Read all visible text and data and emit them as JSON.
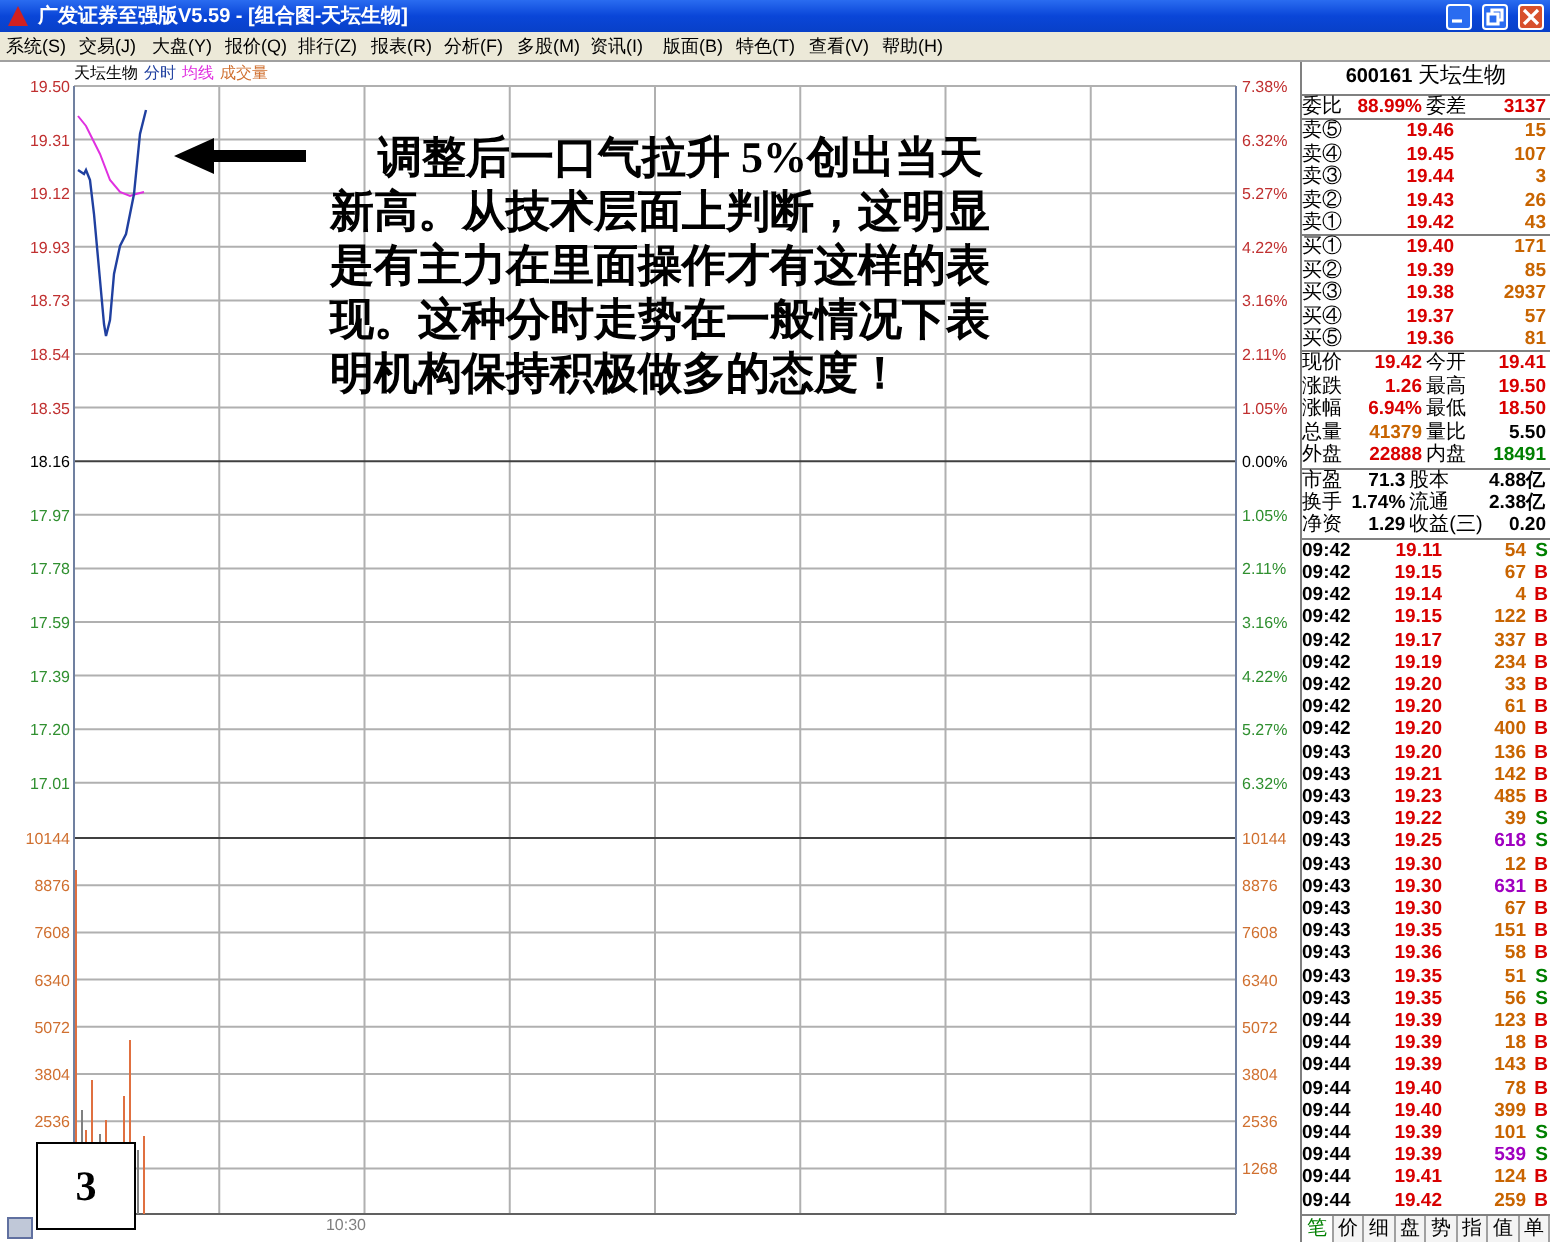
{
  "window": {
    "title": "广发证券至强版V5.59 - [组合图-天坛生物]"
  },
  "menu": [
    "系统(S)",
    "交易(J)",
    "大盘(Y)",
    "报价(Q)",
    "排行(Z)",
    "报表(R)",
    "分析(F)",
    "多股(M)",
    "资讯(I)",
    "版面(B)",
    "特色(T)",
    "查看(V)",
    "帮助(H)"
  ],
  "chart": {
    "legend": [
      {
        "label": "天坛生物",
        "color": "#000000"
      },
      {
        "label": "分时",
        "color": "#2040a0"
      },
      {
        "label": "均线",
        "color": "#e030e0"
      },
      {
        "label": "成交量",
        "color": "#d07030"
      }
    ],
    "left_price_axis": [
      {
        "label": "19.50",
        "color": "#c03030"
      },
      {
        "label": "19.31",
        "color": "#c03030"
      },
      {
        "label": "19.12",
        "color": "#c03030"
      },
      {
        "label": "19.93",
        "color": "#c03030"
      },
      {
        "label": "18.73",
        "color": "#c03030"
      },
      {
        "label": "18.54",
        "color": "#c03030"
      },
      {
        "label": "18.35",
        "color": "#c03030"
      },
      {
        "label": "18.16",
        "color": "#000000"
      },
      {
        "label": "17.97",
        "color": "#309030"
      },
      {
        "label": "17.78",
        "color": "#309030"
      },
      {
        "label": "17.59",
        "color": "#309030"
      },
      {
        "label": "17.39",
        "color": "#309030"
      },
      {
        "label": "17.20",
        "color": "#309030"
      },
      {
        "label": "17.01",
        "color": "#309030"
      }
    ],
    "right_percent_axis": [
      {
        "label": "7.38%",
        "color": "#c03030"
      },
      {
        "label": "6.32%",
        "color": "#c03030"
      },
      {
        "label": "5.27%",
        "color": "#c03030"
      },
      {
        "label": "4.22%",
        "color": "#c03030"
      },
      {
        "label": "3.16%",
        "color": "#c03030"
      },
      {
        "label": "2.11%",
        "color": "#c03030"
      },
      {
        "label": "1.05%",
        "color": "#c03030"
      },
      {
        "label": "0.00%",
        "color": "#000000"
      },
      {
        "label": "1.05%",
        "color": "#309030"
      },
      {
        "label": "2.11%",
        "color": "#309030"
      },
      {
        "label": "3.16%",
        "color": "#309030"
      },
      {
        "label": "4.22%",
        "color": "#309030"
      },
      {
        "label": "5.27%",
        "color": "#309030"
      },
      {
        "label": "6.32%",
        "color": "#309030"
      }
    ],
    "left_volume_axis": [
      "10144",
      "8876",
      "7608",
      "6340",
      "5072",
      "3804",
      "2536"
    ],
    "right_volume_axis": [
      "10144",
      "8876",
      "7608",
      "6340",
      "5072",
      "3804",
      "2536",
      "1268"
    ],
    "time_label": "10:30"
  },
  "annotation": {
    "text": "调整后一口气拉升 5%创出当天新高。从技术层面上判断，这明显是有主力在里面操作才有这样的表现。这种分时走势在一般情况下表明机构保持积极做多的态度！",
    "slide_number": "3"
  },
  "quote": {
    "code": "600161",
    "name": "天坛生物",
    "summary": [
      {
        "cells": [
          {
            "label": "委比",
            "value": "88.99%",
            "color": "#d80000"
          },
          {
            "label": "委差",
            "value": "3137",
            "color": "#d80000"
          }
        ]
      }
    ],
    "asks": [
      {
        "label": "卖⑤",
        "price": "19.46",
        "volume": "15"
      },
      {
        "label": "卖④",
        "price": "19.45",
        "volume": "107"
      },
      {
        "label": "卖③",
        "price": "19.44",
        "volume": "3"
      },
      {
        "label": "卖②",
        "price": "19.43",
        "volume": "26"
      },
      {
        "label": "卖①",
        "price": "19.42",
        "volume": "43"
      }
    ],
    "bids": [
      {
        "label": "买①",
        "price": "19.40",
        "volume": "171"
      },
      {
        "label": "买②",
        "price": "19.39",
        "volume": "85"
      },
      {
        "label": "买③",
        "price": "19.38",
        "volume": "2937"
      },
      {
        "label": "买④",
        "price": "19.37",
        "volume": "57"
      },
      {
        "label": "买⑤",
        "price": "19.36",
        "volume": "81"
      }
    ],
    "stats": [
      {
        "cells": [
          {
            "label": "现价",
            "value": "19.42",
            "color": "#d80000"
          },
          {
            "label": "今开",
            "value": "19.41",
            "color": "#d80000"
          }
        ]
      },
      {
        "cells": [
          {
            "label": "涨跌",
            "value": "1.26",
            "color": "#d80000"
          },
          {
            "label": "最高",
            "value": "19.50",
            "color": "#d80000"
          }
        ]
      },
      {
        "cells": [
          {
            "label": "涨幅",
            "value": "6.94%",
            "color": "#d80000"
          },
          {
            "label": "最低",
            "value": "18.50",
            "color": "#d80000"
          }
        ]
      },
      {
        "cells": [
          {
            "label": "总量",
            "value": "41379",
            "color": "#c86400"
          },
          {
            "label": "量比",
            "value": "5.50",
            "color": "#000000"
          }
        ]
      },
      {
        "cells": [
          {
            "label": "外盘",
            "value": "22888",
            "color": "#d80000"
          },
          {
            "label": "内盘",
            "value": "18491",
            "color": "#008000"
          }
        ]
      }
    ],
    "fundamentals": [
      {
        "cells": [
          {
            "label": "市盈",
            "value": "71.3",
            "color": "#000000"
          },
          {
            "label": "股本",
            "value": "4.88亿",
            "color": "#000000"
          }
        ]
      },
      {
        "cells": [
          {
            "label": "换手",
            "value": "1.74%",
            "color": "#000000"
          },
          {
            "label": "流通",
            "value": "2.38亿",
            "color": "#000000"
          }
        ]
      },
      {
        "cells": [
          {
            "label": "净资",
            "value": "1.29",
            "color": "#000000"
          },
          {
            "label": "收益(三)",
            "value": "0.20",
            "color": "#000000"
          }
        ]
      }
    ]
  },
  "trades": [
    {
      "time": "09:42",
      "price": "19.11",
      "volume": "54",
      "big": false,
      "side": "S",
      "kind": "sell"
    },
    {
      "time": "09:42",
      "price": "19.15",
      "volume": "67",
      "big": false,
      "side": "B",
      "kind": "buy"
    },
    {
      "time": "09:42",
      "price": "19.14",
      "volume": "4",
      "big": false,
      "side": "B",
      "kind": "buy"
    },
    {
      "time": "09:42",
      "price": "19.15",
      "volume": "122",
      "big": false,
      "side": "B",
      "kind": "buy"
    },
    {
      "time": "09:42",
      "price": "19.17",
      "volume": "337",
      "big": false,
      "side": "B",
      "kind": "buy"
    },
    {
      "time": "09:42",
      "price": "19.19",
      "volume": "234",
      "big": false,
      "side": "B",
      "kind": "buy"
    },
    {
      "time": "09:42",
      "price": "19.20",
      "volume": "33",
      "big": false,
      "side": "B",
      "kind": "buy"
    },
    {
      "time": "09:42",
      "price": "19.20",
      "volume": "61",
      "big": false,
      "side": "B",
      "kind": "buy"
    },
    {
      "time": "09:42",
      "price": "19.20",
      "volume": "400",
      "big": false,
      "side": "B",
      "kind": "buy"
    },
    {
      "time": "09:43",
      "price": "19.20",
      "volume": "136",
      "big": false,
      "side": "B",
      "kind": "buy"
    },
    {
      "time": "09:43",
      "price": "19.21",
      "volume": "142",
      "big": false,
      "side": "B",
      "kind": "buy"
    },
    {
      "time": "09:43",
      "price": "19.23",
      "volume": "485",
      "big": false,
      "side": "B",
      "kind": "buy"
    },
    {
      "time": "09:43",
      "price": "19.22",
      "volume": "39",
      "big": false,
      "side": "S",
      "kind": "sell"
    },
    {
      "time": "09:43",
      "price": "19.25",
      "volume": "618",
      "big": true,
      "side": "S",
      "kind": "sell"
    },
    {
      "time": "09:43",
      "price": "19.30",
      "volume": "12",
      "big": false,
      "side": "B",
      "kind": "buy"
    },
    {
      "time": "09:43",
      "price": "19.30",
      "volume": "631",
      "big": true,
      "side": "B",
      "kind": "buy"
    },
    {
      "time": "09:43",
      "price": "19.30",
      "volume": "67",
      "big": false,
      "side": "B",
      "kind": "buy"
    },
    {
      "time": "09:43",
      "price": "19.35",
      "volume": "151",
      "big": false,
      "side": "B",
      "kind": "buy"
    },
    {
      "time": "09:43",
      "price": "19.36",
      "volume": "58",
      "big": false,
      "side": "B",
      "kind": "buy"
    },
    {
      "time": "09:43",
      "price": "19.35",
      "volume": "51",
      "big": false,
      "side": "S",
      "kind": "sell"
    },
    {
      "time": "09:43",
      "price": "19.35",
      "volume": "56",
      "big": false,
      "side": "S",
      "kind": "sell"
    },
    {
      "time": "09:44",
      "price": "19.39",
      "volume": "123",
      "big": false,
      "side": "B",
      "kind": "buy"
    },
    {
      "time": "09:44",
      "price": "19.39",
      "volume": "18",
      "big": false,
      "side": "B",
      "kind": "buy"
    },
    {
      "time": "09:44",
      "price": "19.39",
      "volume": "143",
      "big": false,
      "side": "B",
      "kind": "buy"
    },
    {
      "time": "09:44",
      "price": "19.40",
      "volume": "78",
      "big": false,
      "side": "B",
      "kind": "buy"
    },
    {
      "time": "09:44",
      "price": "19.40",
      "volume": "399",
      "big": false,
      "side": "B",
      "kind": "buy"
    },
    {
      "time": "09:44",
      "price": "19.39",
      "volume": "101",
      "big": false,
      "side": "S",
      "kind": "sell"
    },
    {
      "time": "09:44",
      "price": "19.39",
      "volume": "539",
      "big": true,
      "side": "S",
      "kind": "sell"
    },
    {
      "time": "09:44",
      "price": "19.41",
      "volume": "124",
      "big": false,
      "side": "B",
      "kind": "buy"
    },
    {
      "time": "09:44",
      "price": "19.42",
      "volume": "259",
      "big": false,
      "side": "B",
      "kind": "buy"
    }
  ],
  "tabs": [
    {
      "label": "笔",
      "selected": true
    },
    {
      "label": "价",
      "selected": false
    },
    {
      "label": "细",
      "selected": false
    },
    {
      "label": "盘",
      "selected": false
    },
    {
      "label": "势",
      "selected": false
    },
    {
      "label": "指",
      "selected": false
    },
    {
      "label": "值",
      "selected": false
    },
    {
      "label": "单",
      "selected": false
    }
  ]
}
